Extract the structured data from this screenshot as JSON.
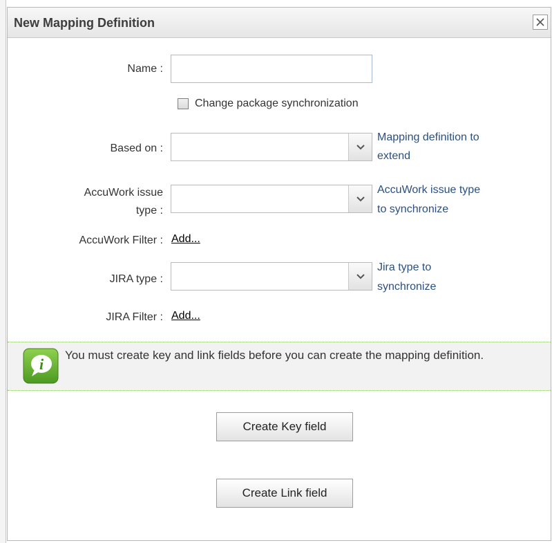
{
  "dialog": {
    "title": "New Mapping Definition",
    "close_icon": "close-icon"
  },
  "form": {
    "name_label": "Name :",
    "name_value": "",
    "change_package_label": "Change package synchronization",
    "change_package_checked": false,
    "based_on_label": "Based on :",
    "based_on_value": "",
    "based_on_hint": [
      "Mapping definition to",
      "extend"
    ],
    "accuwork_type_label": [
      "AccuWork issue",
      "type :"
    ],
    "accuwork_type_value": "",
    "accuwork_type_hint": [
      "AccuWork issue type",
      "to synchronize"
    ],
    "accuwork_filter_label": "AccuWork Filter :",
    "accuwork_filter_link": "Add...",
    "jira_type_label": "JIRA type :",
    "jira_type_value": "",
    "jira_type_hint": [
      "Jira type to",
      "synchronize"
    ],
    "jira_filter_label": "JIRA Filter :",
    "jira_filter_link": "Add..."
  },
  "info": {
    "icon": "info-icon",
    "message": "You must create key and link fields before you can create the mapping definition."
  },
  "buttons": {
    "create_key": "Create Key field",
    "create_link": "Create Link field"
  },
  "colors": {
    "hint_text": "#2a4f80",
    "info_border": "#8ec16a",
    "info_icon_green": "#5aa62a"
  }
}
